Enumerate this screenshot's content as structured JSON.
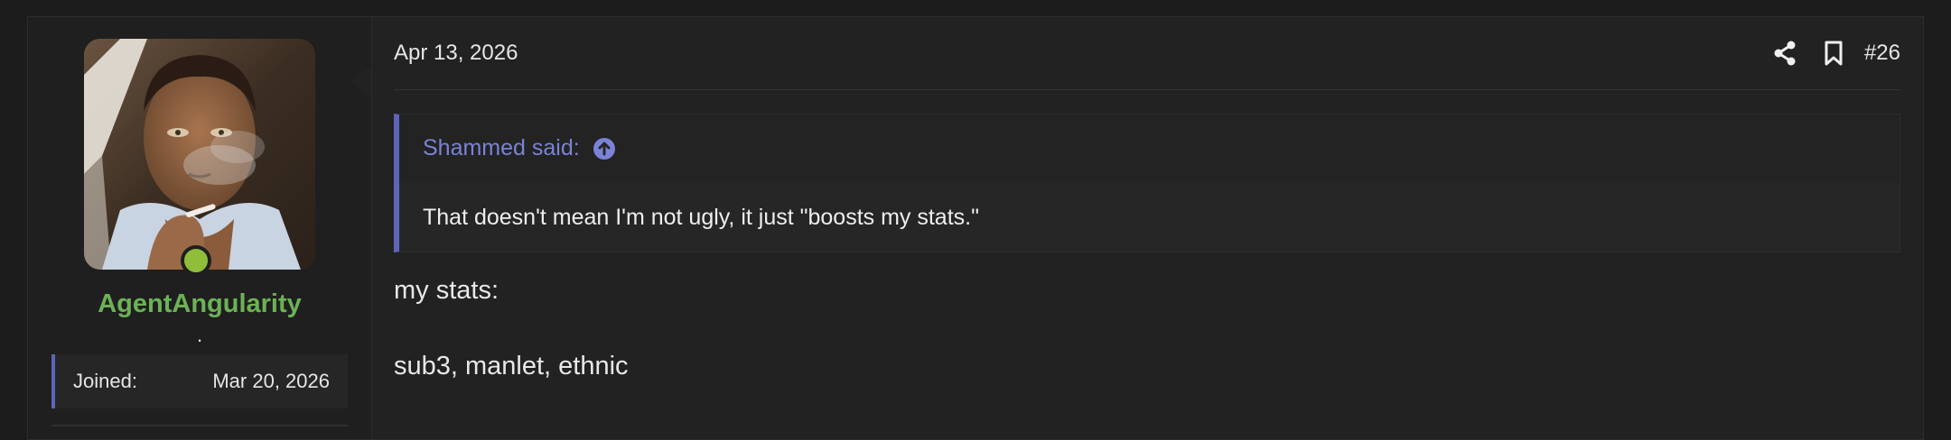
{
  "user": {
    "username": "AgentAngularity",
    "user_title": ".",
    "online": true,
    "avatar_icon": "user-avatar-photo",
    "stats": {
      "joined_label": "Joined:",
      "joined_value": "Mar 20, 2026"
    }
  },
  "post": {
    "date": "Apr 13, 2026",
    "number": "#26",
    "actions": [
      "share-icon",
      "bookmark-icon"
    ],
    "quote": {
      "author_line": "Shammed said:",
      "jump_icon": "arrow-up-circle-icon",
      "text": "That doesn't mean I'm not ugly, it just \"boosts my stats.\""
    },
    "message_lines": [
      "my stats:",
      "sub3, manlet, ethnic"
    ]
  },
  "colors": {
    "background": "#1c1c1c",
    "panel": "#222222",
    "username": "#6cb256",
    "accent": "#5c66b8",
    "quote_author": "#7a83d6",
    "online": "#8fbf3a"
  }
}
